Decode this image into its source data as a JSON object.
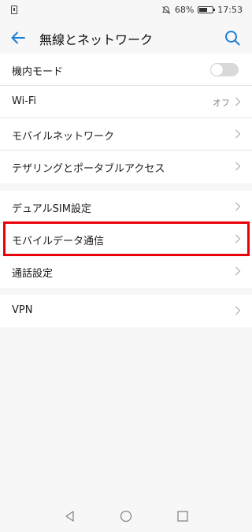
{
  "status_bar": {
    "battery_percent": "68%",
    "time": "17:53",
    "battery_level": 0.68
  },
  "header": {
    "title": "無線とネットワーク"
  },
  "group1": [
    {
      "label": "機内モード",
      "type": "toggle",
      "toggle_on": false
    },
    {
      "label": "Wi-Fi",
      "value": "オフ",
      "type": "chevron"
    },
    {
      "label": "モバイルネットワーク",
      "type": "chevron"
    },
    {
      "label": "テザリングとポータブルアクセス",
      "type": "chevron"
    }
  ],
  "group2": [
    {
      "label": "デュアルSIM設定",
      "type": "chevron"
    },
    {
      "label": "モバイルデータ通信",
      "type": "chevron",
      "highlighted": true
    },
    {
      "label": "通話設定",
      "type": "chevron"
    }
  ],
  "group3": [
    {
      "label": "VPN",
      "type": "chevron"
    }
  ],
  "colors": {
    "accent": "#1a7fd6",
    "highlight": "#e8000b",
    "toggle_off": "#d9d9d9"
  }
}
